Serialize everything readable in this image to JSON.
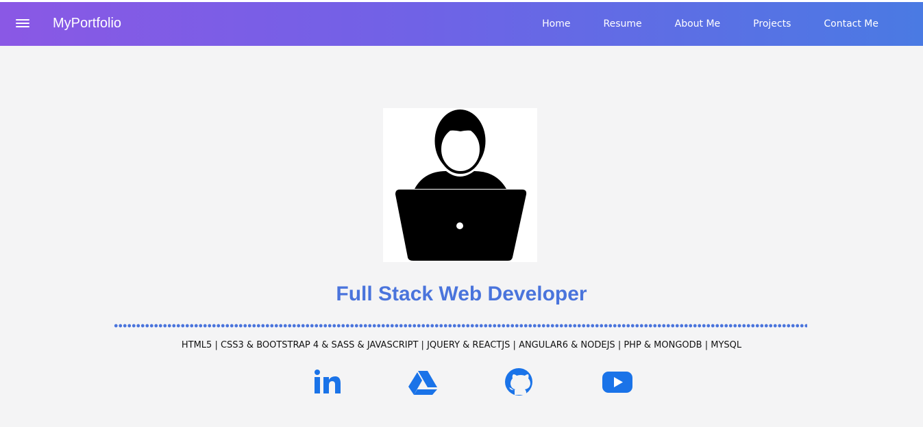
{
  "header": {
    "brand": "MyPortfolio",
    "menu_icon": "hamburger-menu-icon",
    "nav": [
      {
        "label": "Home"
      },
      {
        "label": "Resume"
      },
      {
        "label": "About Me"
      },
      {
        "label": "Projects"
      },
      {
        "label": "Contact Me"
      }
    ],
    "gradient_start": "#8a58e5",
    "gradient_end": "#4a7ae3"
  },
  "hero": {
    "avatar_icon": "developer-laptop-icon",
    "title": "Full Stack Web Developer",
    "skills": "HTML5 | CSS3 & BOOTSTRAP 4 & SASS & JAVASCRIPT | JQUERY & REACTJS | ANGULAR6 & NODEJS | PHP & MONGODB | MYSQL",
    "accent_color": "#4a74dc"
  },
  "social": [
    {
      "icon": "linkedin-icon"
    },
    {
      "icon": "google-drive-icon"
    },
    {
      "icon": "github-icon"
    },
    {
      "icon": "youtube-icon"
    }
  ],
  "colors": {
    "background": "#f4f4f5",
    "social_icon": "#1a73e8"
  }
}
